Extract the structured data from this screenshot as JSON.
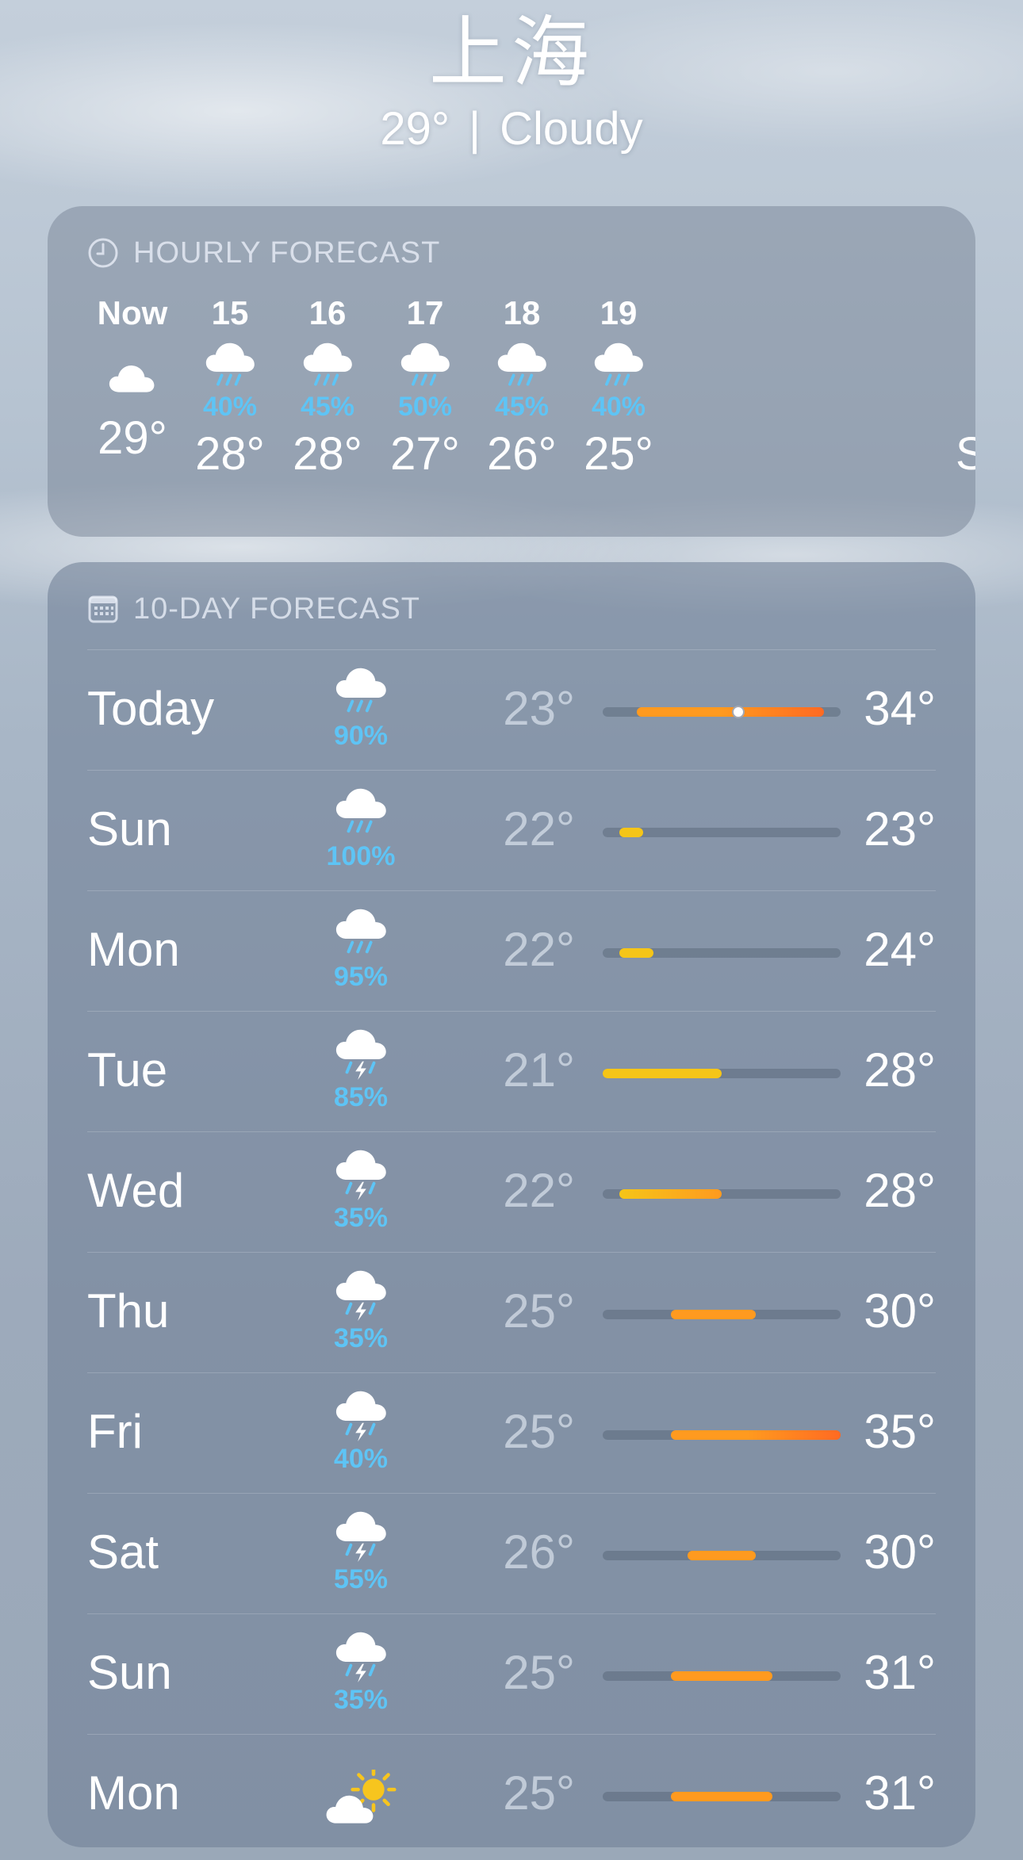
{
  "location": {
    "city": "上海",
    "current_temp": "29°",
    "condition": "Cloudy",
    "separator": "|"
  },
  "hourly": {
    "header": "HOURLY FORECAST",
    "header_icon": "clock-icon",
    "items": [
      {
        "time": "Now",
        "icon": "cloud-icon",
        "precip": "",
        "temp": "29°"
      },
      {
        "time": "15",
        "icon": "cloud-rain-icon",
        "precip": "40%",
        "temp": "28°"
      },
      {
        "time": "16",
        "icon": "cloud-rain-icon",
        "precip": "45%",
        "temp": "28°"
      },
      {
        "time": "17",
        "icon": "cloud-rain-icon",
        "precip": "50%",
        "temp": "27°"
      },
      {
        "time": "18",
        "icon": "cloud-rain-icon",
        "precip": "45%",
        "temp": "26°"
      },
      {
        "time": "19",
        "icon": "cloud-rain-icon",
        "precip": "40%",
        "temp": "25°"
      }
    ],
    "partial_next_label": "S"
  },
  "daily": {
    "header": "10-DAY FORECAST",
    "header_icon": "calendar-icon",
    "range_min": 21,
    "range_max": 35,
    "current_temp_value": 29,
    "colors": {
      "precip": "#5ec4f5",
      "cool": "#f5c518",
      "warm": "#ff9a1f",
      "hot": "#ff6a22"
    },
    "days": [
      {
        "day": "Today",
        "icon": "cloud-rain-icon",
        "precip": "90%",
        "low": "23°",
        "high": "34°",
        "low_v": 23,
        "high_v": 34,
        "show_current": true
      },
      {
        "day": "Sun",
        "icon": "cloud-rain-icon",
        "precip": "100%",
        "low": "22°",
        "high": "23°",
        "low_v": 22,
        "high_v": 23
      },
      {
        "day": "Mon",
        "icon": "cloud-rain-icon",
        "precip": "95%",
        "low": "22°",
        "high": "24°",
        "low_v": 22,
        "high_v": 24
      },
      {
        "day": "Tue",
        "icon": "cloud-bolt-rain-icon",
        "precip": "85%",
        "low": "21°",
        "high": "28°",
        "low_v": 21,
        "high_v": 28
      },
      {
        "day": "Wed",
        "icon": "cloud-bolt-rain-icon",
        "precip": "35%",
        "low": "22°",
        "high": "28°",
        "low_v": 22,
        "high_v": 28
      },
      {
        "day": "Thu",
        "icon": "cloud-bolt-rain-icon",
        "precip": "35%",
        "low": "25°",
        "high": "30°",
        "low_v": 25,
        "high_v": 30
      },
      {
        "day": "Fri",
        "icon": "cloud-bolt-rain-icon",
        "precip": "40%",
        "low": "25°",
        "high": "35°",
        "low_v": 25,
        "high_v": 35
      },
      {
        "day": "Sat",
        "icon": "cloud-bolt-rain-icon",
        "precip": "55%",
        "low": "26°",
        "high": "30°",
        "low_v": 26,
        "high_v": 30
      },
      {
        "day": "Sun",
        "icon": "cloud-bolt-rain-icon",
        "precip": "35%",
        "low": "25°",
        "high": "31°",
        "low_v": 25,
        "high_v": 31
      },
      {
        "day": "Mon",
        "icon": "cloud-sun-icon",
        "precip": "",
        "low": "25°",
        "high": "31°",
        "low_v": 25,
        "high_v": 31
      }
    ]
  }
}
